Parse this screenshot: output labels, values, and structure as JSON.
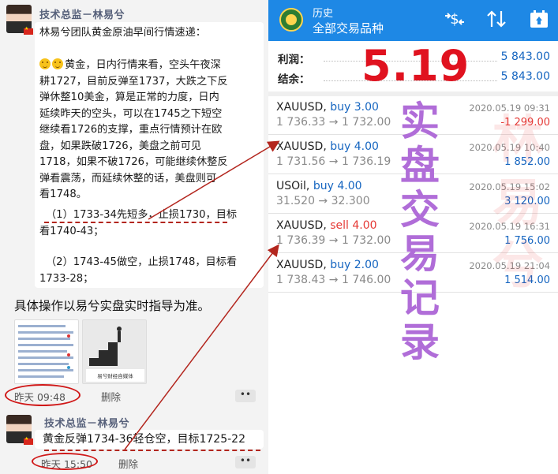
{
  "chat": {
    "sender": "技术总监－林易兮",
    "message1": {
      "lines": [
        "林易兮团队黄金原油早间行情速递：",
        "",
        "黄金，日内行情来看，空头午夜深",
        "耕1727，目前反弹至1737，大跌之下反",
        "弹休整10美金，算是正常的力度，日内",
        "延续昨天的空头，可以在1745之下短空",
        "继续看1726的支撑，重点行情预计在欧",
        "盘，如果跌破1726，美盘之前可见",
        "1718，如果不破1726，可能继续休整反",
        "弹看震荡，而延续休整的话，美盘则可",
        "看1748。",
        "",
        "（1）1733-34先短多，止损1730，目标",
        "看1740-43；",
        "",
        "（2）1743-45做空，止损1748，目标看",
        "1733-28；"
      ]
    },
    "note": "具体操作以易兮实盘实时指导为准。",
    "thumb_caption": "易兮财经自媒体",
    "time1": "昨天 09:48",
    "delete_label": "删除",
    "more_label": "••",
    "message2": "黄金反弹1734-36轻仓空，目标1725-22",
    "time2": "昨天 15:50"
  },
  "app": {
    "title": "历史",
    "subtitle": "全部交易品种",
    "summary": [
      {
        "label": "利润：",
        "value": "5 843.00"
      },
      {
        "label": "结余：",
        "value": "5 843.00"
      }
    ],
    "trades": [
      {
        "symbol": "XAUUSD,",
        "side": "buy 3.00",
        "side_color": "#1565c0",
        "prices": "1 736.33 → 1 732.00",
        "date": "2020.05.19 09:31",
        "profit": "-1 299.00",
        "profit_color": "#e53935"
      },
      {
        "symbol": "XAUUSD,",
        "side": "buy 4.00",
        "side_color": "#1565c0",
        "prices": "1 731.56 → 1 736.19",
        "date": "2020.05.19 10:40",
        "profit": "1 852.00",
        "profit_color": "#1565c0"
      },
      {
        "symbol": "USOil,",
        "side": "buy 4.00",
        "side_color": "#1565c0",
        "prices": "31.520 → 32.300",
        "date": "2020.05.19 15:02",
        "profit": "3 120.00",
        "profit_color": "#1565c0"
      },
      {
        "symbol": "XAUUSD,",
        "side": "sell 4.00",
        "side_color": "#e53935",
        "prices": "1 736.39 → 1 732.00",
        "date": "2020.05.19 16:31",
        "profit": "1 756.00",
        "profit_color": "#1565c0"
      },
      {
        "symbol": "XAUUSD,",
        "side": "buy 2.00",
        "side_color": "#1565c0",
        "prices": "1 738.43 → 1 746.00",
        "date": "2020.05.19 21:04",
        "profit": "1 514.00",
        "profit_color": "#1565c0"
      }
    ]
  },
  "overlay": {
    "date": "5.19",
    "title": "实盘交易记录",
    "watermark": "林易兮"
  },
  "icons": [
    "avatar-icon",
    "china-flag-icon",
    "smile-emoji-icon",
    "app-logo-icon",
    "dollar-swap-icon",
    "sort-arrows-icon",
    "calendar-icon"
  ]
}
